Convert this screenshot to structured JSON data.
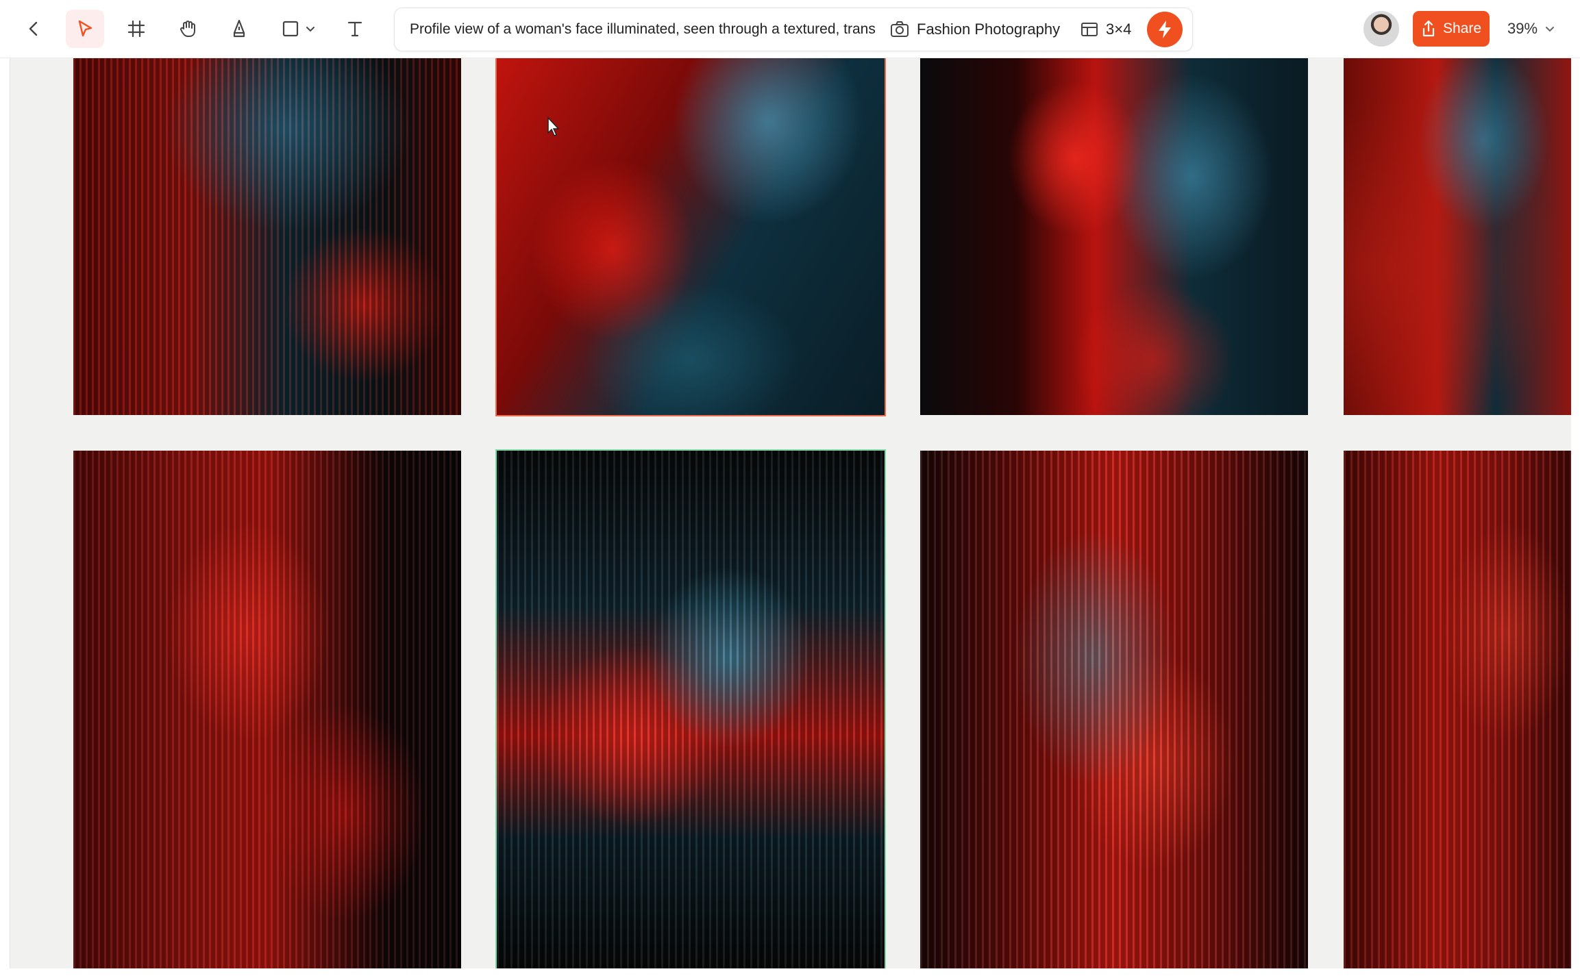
{
  "toolbar": {
    "tools": [
      {
        "name": "back",
        "icon": "chevron-left-icon"
      },
      {
        "name": "select",
        "icon": "pointer-arrow-icon",
        "active": true
      },
      {
        "name": "frame",
        "icon": "hash-frame-icon"
      },
      {
        "name": "hand",
        "icon": "hand-icon"
      },
      {
        "name": "pen",
        "icon": "pen-nib-icon"
      },
      {
        "name": "shape",
        "icon": "square-icon"
      },
      {
        "name": "text",
        "icon": "text-tool-icon"
      }
    ],
    "prompt": "Profile view of a woman's face illuminated, seen through a textured, trans",
    "style_label": "Fashion Photography",
    "grid_label": "3×4",
    "share_label": "Share",
    "zoom_label": "39%",
    "accent": "#f0501f"
  },
  "gallery": {
    "images": [
      {
        "id": "img-r1c1",
        "desc": "woman profile behind ribbed glass, red and teal light"
      },
      {
        "id": "img-r1c2",
        "desc": "woman face red and blue light, selected"
      },
      {
        "id": "img-r1c3",
        "desc": "woman profile red and teal light"
      },
      {
        "id": "img-r1c4",
        "desc": "woman profile behind frosted glass"
      },
      {
        "id": "img-r2c1",
        "desc": "woman profile red light, ribbed glass"
      },
      {
        "id": "img-r2c2",
        "desc": "woman face behind fluted glass, selected"
      },
      {
        "id": "img-r2c3",
        "desc": "woman face behind fluted glass, red light"
      },
      {
        "id": "img-r2c4",
        "desc": "woman face behind fluted glass"
      }
    ]
  }
}
